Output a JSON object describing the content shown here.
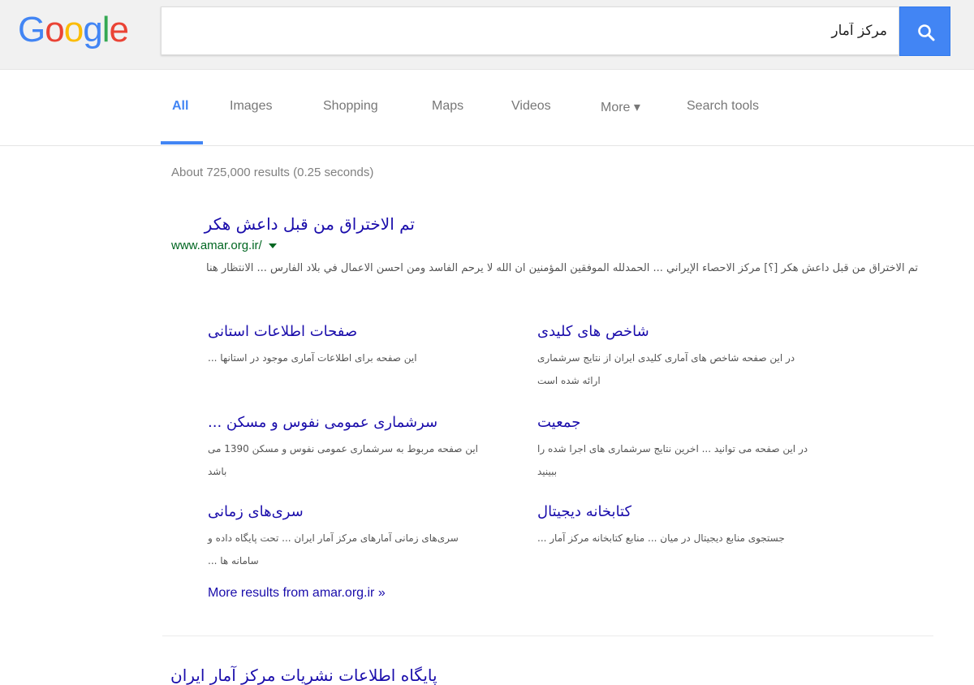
{
  "logo": {
    "letters": [
      "G",
      "o",
      "o",
      "g",
      "l",
      "e"
    ],
    "colors": [
      "#4285f4",
      "#ea4335",
      "#fbbc05",
      "#4285f4",
      "#34a853",
      "#ea4335"
    ]
  },
  "search": {
    "query": "مرکز آمار",
    "button_icon": "search-icon"
  },
  "tabs": {
    "items": [
      {
        "label": "All",
        "active": true
      },
      {
        "label": "Images",
        "active": false
      },
      {
        "label": "Shopping",
        "active": false
      },
      {
        "label": "Maps",
        "active": false
      },
      {
        "label": "Videos",
        "active": false
      },
      {
        "label": "More ▾",
        "active": false
      },
      {
        "label": "Search tools",
        "active": false
      }
    ]
  },
  "stats": "About 725,000 results (0.25 seconds)",
  "result1": {
    "title": "تم الاختراق من قبل داعش هكر",
    "url": "www.amar.org.ir/",
    "snippet": "تم الاختراق من قبل داعش هکر [؟] مرکز الاحصاء الإيراني ... الحمدلله الموفقين المؤمنين ان الله لا يرحم الفاسد ومن احسن الاعمال في بلاد الفارس ... الانتظار هنا"
  },
  "sitelinks": [
    {
      "title": "صفحات اطلاعات استانی",
      "snippet": "این صفحه برای اطلاعات آماری موجود در استانها ..."
    },
    {
      "title": "شاخص های کلیدی",
      "snippet": "در این صفحه شاخص های آماری کلیدی ایران از نتایج سرشماری ارائه شده است"
    },
    {
      "title": "سرشماری عمومی نفوس و مسکن ...",
      "snippet": "این صفحه مربوط به سرشماری عمومی نفوس و مسکن 1390 می باشد"
    },
    {
      "title": "جمعیت",
      "snippet": "در این صفحه می توانید ... اخرین نتایج سرشماری های اجرا شده را ببینید"
    },
    {
      "title": "سری‌های زمانی",
      "snippet": "سری‌های زمانی آمارهای مرکز آمار ایران ... تحت پایگاه داده و سامانه ها ..."
    },
    {
      "title": "کتابخانه دیجیتال",
      "snippet": "جستجوی منابع دیجیتال در میان ... منابع کتابخانه مرکز آمار ..."
    }
  ],
  "more_results": "More results from amar.org.ir »",
  "result2": {
    "title": "پایگاه اطلاعات نشریات مرکز آمار ایران"
  }
}
